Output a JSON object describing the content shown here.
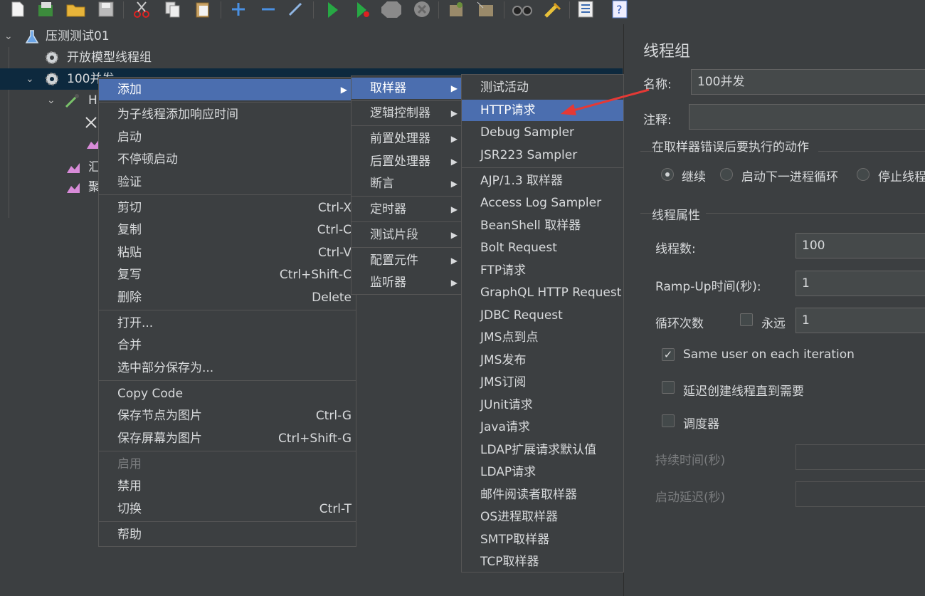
{
  "toolbar": {
    "icons": [
      "new-icon",
      "templates-icon",
      "open-icon",
      "save-icon",
      "cut-icon",
      "copy-icon",
      "paste-icon",
      "expand-icon",
      "collapse-icon",
      "toggle-icon",
      "start-icon",
      "start-no-pause-icon",
      "stop-icon",
      "shutdown-icon",
      "clear-icon",
      "clear-all-icon",
      "search-icon",
      "reset-search-icon",
      "function-helper-icon",
      "help-icon"
    ]
  },
  "tree": {
    "items": [
      {
        "label": "压测测试01"
      },
      {
        "label": "开放模型线程组"
      },
      {
        "label": "100并发"
      },
      {
        "label": "H"
      },
      {
        "label": ""
      },
      {
        "label": ""
      },
      {
        "label": "汇"
      },
      {
        "label": "聚"
      }
    ]
  },
  "context_menu": {
    "items": [
      {
        "label": "添加"
      },
      {
        "label": "为子线程添加响应时间"
      },
      {
        "label": "启动"
      },
      {
        "label": "不停顿启动"
      },
      {
        "label": "验证"
      },
      {
        "label": "剪切",
        "shortcut": "Ctrl-X"
      },
      {
        "label": "复制",
        "shortcut": "Ctrl-C"
      },
      {
        "label": "粘贴",
        "shortcut": "Ctrl-V"
      },
      {
        "label": "复写",
        "shortcut": "Ctrl+Shift-C"
      },
      {
        "label": "删除",
        "shortcut": "Delete"
      },
      {
        "label": "打开..."
      },
      {
        "label": "合并"
      },
      {
        "label": "选中部分保存为..."
      },
      {
        "label": "Copy Code"
      },
      {
        "label": "保存节点为图片",
        "shortcut": "Ctrl-G"
      },
      {
        "label": "保存屏幕为图片",
        "shortcut": "Ctrl+Shift-G"
      },
      {
        "label": "启用"
      },
      {
        "label": "禁用"
      },
      {
        "label": "切换",
        "shortcut": "Ctrl-T"
      },
      {
        "label": "帮助"
      }
    ]
  },
  "add_menu": {
    "items": [
      {
        "label": "取样器"
      },
      {
        "label": "逻辑控制器"
      },
      {
        "label": "前置处理器"
      },
      {
        "label": "后置处理器"
      },
      {
        "label": "断言"
      },
      {
        "label": "定时器"
      },
      {
        "label": "测试片段"
      },
      {
        "label": "配置元件"
      },
      {
        "label": "监听器"
      }
    ]
  },
  "sampler_menu": {
    "items": [
      {
        "label": "测试活动"
      },
      {
        "label": "HTTP请求"
      },
      {
        "label": "Debug Sampler"
      },
      {
        "label": "JSR223 Sampler"
      },
      {
        "label": "AJP/1.3 取样器"
      },
      {
        "label": "Access Log Sampler"
      },
      {
        "label": "BeanShell 取样器"
      },
      {
        "label": "Bolt Request"
      },
      {
        "label": "FTP请求"
      },
      {
        "label": "GraphQL HTTP Request"
      },
      {
        "label": "JDBC Request"
      },
      {
        "label": "JMS点到点"
      },
      {
        "label": "JMS发布"
      },
      {
        "label": "JMS订阅"
      },
      {
        "label": "JUnit请求"
      },
      {
        "label": "Java请求"
      },
      {
        "label": "LDAP扩展请求默认值"
      },
      {
        "label": "LDAP请求"
      },
      {
        "label": "邮件阅读者取样器"
      },
      {
        "label": "OS进程取样器"
      },
      {
        "label": "SMTP取样器"
      },
      {
        "label": "TCP取样器"
      }
    ]
  },
  "panel": {
    "title": "线程组",
    "name_label": "名称:",
    "name_value": "100并发",
    "comment_label": "注释:",
    "comment_value": "",
    "error_group_title": "在取样器错误后要执行的动作",
    "error_options": [
      "继续",
      "启动下一进程循环",
      "停止线程"
    ],
    "error_selected": "继续",
    "props_title": "线程属性",
    "threads_label": "线程数:",
    "threads_value": "100",
    "rampup_label": "Ramp-Up时间(秒):",
    "rampup_value": "1",
    "loop_label": "循环次数",
    "forever_label": "永远",
    "forever_checked": false,
    "loop_value": "1",
    "same_user_label": "Same user on each iteration",
    "same_user_checked": true,
    "delay_label": "延迟创建线程直到需要",
    "delay_checked": false,
    "scheduler_label": "调度器",
    "scheduler_checked": false,
    "duration_label": "持续时间(秒)",
    "startup_delay_label": "启动延迟(秒)"
  },
  "colors": {
    "background": "#3c3f41",
    "highlight": "#4b6eaf",
    "tree_selection": "#0d293e",
    "arrow": "#e53935"
  }
}
